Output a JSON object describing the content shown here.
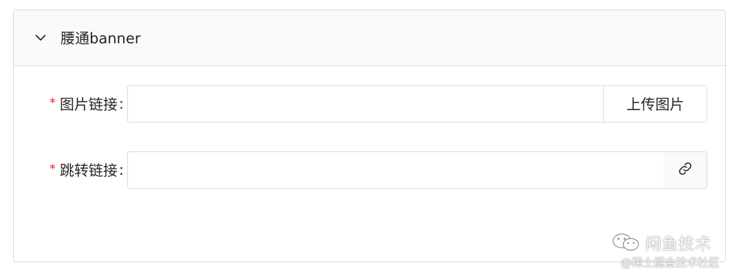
{
  "panel": {
    "title": "腰通banner",
    "expanded_icon": "chevron-down-icon"
  },
  "form": {
    "fields": [
      {
        "required_mark": "*",
        "label": "图片链接",
        "colon": ":",
        "value": "",
        "placeholder": "",
        "addon_button_label": "上传图片"
      },
      {
        "required_mark": "*",
        "label": "跳转链接",
        "colon": ":",
        "value": "",
        "placeholder": "",
        "addon_icon": "link-icon"
      }
    ]
  },
  "watermark": {
    "title": "闲鱼技术",
    "subtitle": "@稀土掘金技术社区",
    "icon": "wechat-icon"
  },
  "colors": {
    "required": "#f5222d",
    "border": "#d9d9d9",
    "header_bg": "#fafafa",
    "text": "#262626"
  }
}
